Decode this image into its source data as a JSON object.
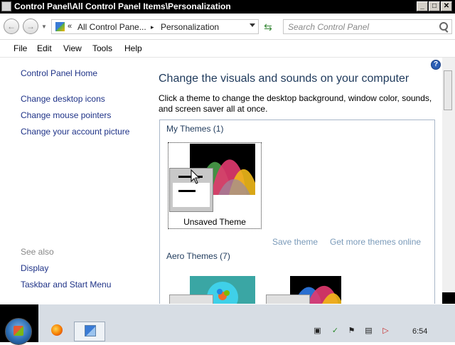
{
  "window": {
    "title": "Control Panel\\All Control Panel Items\\Personalization",
    "buttons": {
      "minimize": "_",
      "maximize": "□",
      "close": "✕"
    }
  },
  "address": {
    "overflow_glyph": "«",
    "crumbs": [
      "All Control Pane...",
      "Personalization"
    ],
    "separator": "▸"
  },
  "search": {
    "placeholder": "Search Control Panel"
  },
  "menu": [
    "File",
    "Edit",
    "View",
    "Tools",
    "Help"
  ],
  "sidebar": {
    "home": "Control Panel Home",
    "tasks": [
      "Change desktop icons",
      "Change mouse pointers",
      "Change your account picture"
    ],
    "see_also_label": "See also",
    "see_also": [
      "Display",
      "Taskbar and Start Menu"
    ]
  },
  "main": {
    "title": "Change the visuals and sounds on your computer",
    "description": "Click a theme to change the desktop background, window color, sounds, and screen saver all at once.",
    "help_glyph": "?",
    "my_themes": {
      "heading": "My Themes (1)",
      "items": [
        {
          "name": "Unsaved Theme",
          "selected": true
        }
      ]
    },
    "actions": [
      "Save theme",
      "Get more themes online"
    ],
    "aero_themes": {
      "heading": "Aero Themes (7)"
    }
  },
  "taskbar": {
    "clock": "6:54",
    "tray_icons": [
      "notepad-icon",
      "check-shield-icon",
      "flag-icon",
      "network-icon",
      "speaker-muted-icon"
    ]
  },
  "colors": {
    "link": "#1e3287",
    "heading": "#1e395b",
    "faded_link": "#7a9ab9",
    "taskbar": "#d7dde4"
  }
}
